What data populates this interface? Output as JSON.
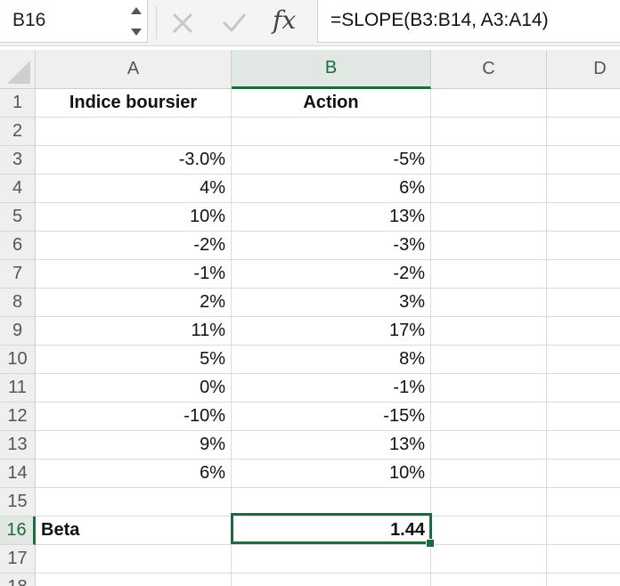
{
  "name_box": {
    "value": "B16"
  },
  "formula_bar": {
    "fx_label": "fx",
    "formula": "=SLOPE(B3:B14, A3:A14)",
    "cancel_icon": "x-icon",
    "confirm_icon": "checkmark-icon"
  },
  "columns": [
    "A",
    "B",
    "C",
    "D"
  ],
  "selected_column": "B",
  "selected_row": "16",
  "accent_color": "#1d6b3f",
  "rows": [
    {
      "num": "1",
      "a": "Indice boursier",
      "b": "Action"
    },
    {
      "num": "2",
      "a": "",
      "b": ""
    },
    {
      "num": "3",
      "a": "-3.0%",
      "b": "-5%"
    },
    {
      "num": "4",
      "a": "4%",
      "b": "6%"
    },
    {
      "num": "5",
      "a": "10%",
      "b": "13%"
    },
    {
      "num": "6",
      "a": "-2%",
      "b": "-3%"
    },
    {
      "num": "7",
      "a": "-1%",
      "b": "-2%"
    },
    {
      "num": "8",
      "a": "2%",
      "b": "3%"
    },
    {
      "num": "9",
      "a": "11%",
      "b": "17%"
    },
    {
      "num": "10",
      "a": "5%",
      "b": "8%"
    },
    {
      "num": "11",
      "a": "0%",
      "b": "-1%"
    },
    {
      "num": "12",
      "a": "-10%",
      "b": "-15%"
    },
    {
      "num": "13",
      "a": "9%",
      "b": "13%"
    },
    {
      "num": "14",
      "a": "6%",
      "b": "10%"
    },
    {
      "num": "15",
      "a": "",
      "b": ""
    },
    {
      "num": "16",
      "a": "Beta",
      "b": "1.44"
    },
    {
      "num": "17",
      "a": "",
      "b": ""
    },
    {
      "num": "18",
      "a": "",
      "b": ""
    }
  ]
}
